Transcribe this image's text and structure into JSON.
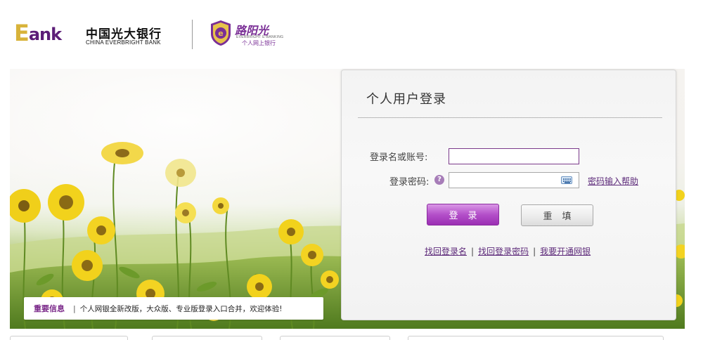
{
  "header": {
    "ebank_logo_e": "E",
    "ebank_logo_rest": "ank",
    "bank_name_cn": "中国光大银行",
    "bank_name_en": "CHINA EVERBRIGHT BANK",
    "sub_brand_title": "阳光",
    "sub_brand_title_prefix": "路",
    "sub_brand_en": "EVERBRIGHT E-BANKING",
    "sub_brand_subtitle": "个人网上银行"
  },
  "notice": {
    "title": "重要信息",
    "separator": "|",
    "text": "个人网银全新改版，大众版、专业版登录入口合并，欢迎体验!"
  },
  "login": {
    "title": "个人用户登录",
    "username_label": "登录名或账号:",
    "username_value": "",
    "password_label": "登录密码:",
    "help_icon_glyph": "?",
    "password_value": "",
    "password_help_link": "密码输入帮助",
    "login_button": "登录",
    "reset_button": "重填",
    "links": [
      "找回登录名",
      "找回登录密码",
      "我要开通网银"
    ],
    "link_separator": "|"
  },
  "colors": {
    "brand_purple": "#7b2a8a",
    "brand_gold": "#d8b33a",
    "login_button_bg": "#b34fc9"
  }
}
